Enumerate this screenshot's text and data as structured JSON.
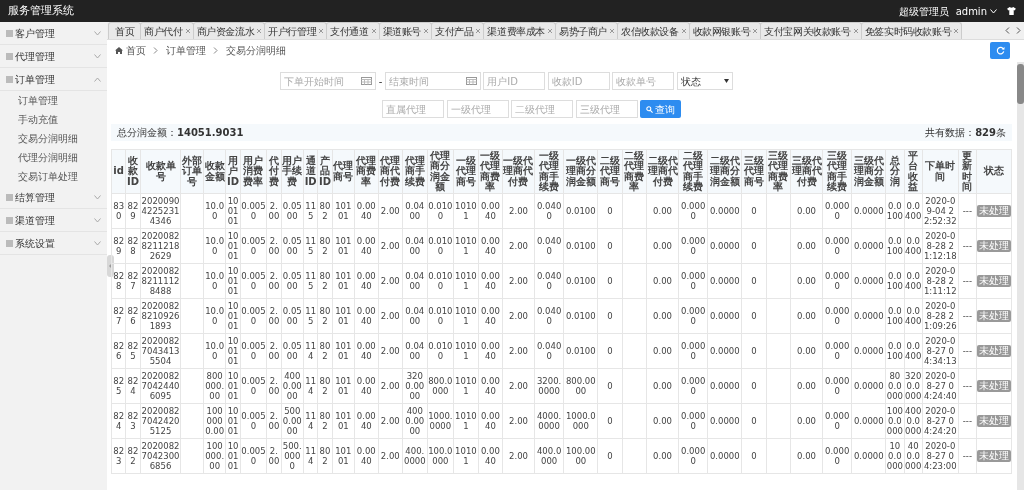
{
  "app": {
    "title": "服务管理系统",
    "user_role": "超级管理员",
    "user_name": "admin"
  },
  "sidebar": {
    "items": [
      {
        "label": "客户管理",
        "expanded": false
      },
      {
        "label": "代理管理",
        "expanded": false
      },
      {
        "label": "订单管理",
        "expanded": true,
        "children": [
          {
            "label": "订单管理"
          },
          {
            "label": "手动充值"
          },
          {
            "label": "交易分润明细"
          },
          {
            "label": "代理分润明细"
          },
          {
            "label": "交易订单处理"
          }
        ]
      },
      {
        "label": "结算管理",
        "expanded": false
      },
      {
        "label": "渠道管理",
        "expanded": false
      },
      {
        "label": "系统设置",
        "expanded": false
      }
    ]
  },
  "tabs": [
    {
      "label": "首页",
      "closable": false
    },
    {
      "label": "商户代付",
      "closable": true
    },
    {
      "label": "商户资金流水",
      "closable": true
    },
    {
      "label": "开户行管理",
      "closable": true
    },
    {
      "label": "支付通道",
      "closable": true
    },
    {
      "label": "渠道账号",
      "closable": true
    },
    {
      "label": "支付产品",
      "closable": true
    },
    {
      "label": "渠道费率成本",
      "closable": true
    },
    {
      "label": "易势子商户",
      "closable": true
    },
    {
      "label": "农信收款设备",
      "closable": true
    },
    {
      "label": "收款网银账号",
      "closable": true
    },
    {
      "label": "支付宝网关收款账号",
      "closable": true
    },
    {
      "label": "免签实时码收款账号",
      "closable": true
    }
  ],
  "breadcrumb": [
    "首页",
    "订单管理",
    "交易分润明细"
  ],
  "filters": {
    "row_1": [
      {
        "kind": "date",
        "placeholder": "下单开始时间"
      },
      {
        "kind": "separator",
        "text": "-"
      },
      {
        "kind": "date",
        "placeholder": "结束时间"
      },
      {
        "kind": "text",
        "placeholder": "用户ID"
      },
      {
        "kind": "text",
        "placeholder": "收款ID"
      },
      {
        "kind": "text",
        "placeholder": "收款单号"
      },
      {
        "kind": "select",
        "value": "状态"
      }
    ],
    "row_2": [
      {
        "kind": "text",
        "placeholder": "直属代理"
      },
      {
        "kind": "text",
        "placeholder": "一级代理"
      },
      {
        "kind": "text",
        "placeholder": "二级代理"
      },
      {
        "kind": "text",
        "placeholder": "三级代理"
      },
      {
        "kind": "button",
        "text": "查询"
      }
    ]
  },
  "summary": {
    "label": "总分润金额：",
    "value": "14051.9031",
    "count_label": "共有数据：",
    "count": "829",
    "count_unit": "条"
  },
  "table": {
    "columns": [
      "id",
      "收款ID",
      "收款单号",
      "外部订单号",
      "收款金额",
      "用户ID",
      "用户消费费率",
      "代付费",
      "用户手续费",
      "通道ID",
      "产品ID",
      "代理商号",
      "代理商费率",
      "代理商代付费",
      "代理商手续费",
      "代理商分润金额",
      "一级代理商号",
      "一级代理商费率",
      "一级代理商代付费",
      "一级代理商手续费",
      "一级代理商分润金额",
      "二级代理商号",
      "二级代理商费率",
      "二级代理商代付费",
      "二级代理商手续费",
      "二级代理商分润金额",
      "三级代理商号",
      "三级代理商费率",
      "三级代理商代付费",
      "三级代理商手续费",
      "三级代理商分润金额",
      "总分润",
      "平台收益",
      "下单时间",
      "更新时间",
      "状态"
    ],
    "rows": [
      [
        "830",
        "829",
        "202009042252314346",
        "",
        "10.00",
        "100101",
        "0.0050",
        "2.00",
        "0.0500",
        "115",
        "802",
        "10101",
        "0.0040",
        "2.00",
        "0.0400",
        "0.0100",
        "10101",
        "0.0040",
        "2.00",
        "0.0400",
        "0.0100",
        "0",
        "",
        "0.00",
        "0.0000",
        "0.0000",
        "0",
        "",
        "0.00",
        "0.0000",
        "0.0000",
        "0.0100",
        "0.0400",
        "2020-09-04 22:52:32",
        "---",
        "未处理"
      ],
      [
        "829",
        "828",
        "202008282112182629",
        "",
        "10.00",
        "100101",
        "0.0050",
        "2.00",
        "0.0500",
        "115",
        "802",
        "10101",
        "0.0040",
        "2.00",
        "0.0400",
        "0.0100",
        "10101",
        "0.0040",
        "2.00",
        "0.0400",
        "0.0100",
        "0",
        "",
        "0.00",
        "0.0000",
        "0.0000",
        "0",
        "",
        "0.00",
        "0.0000",
        "0.0000",
        "0.0100",
        "0.0400",
        "2020-08-28 21:12:18",
        "---",
        "未处理"
      ],
      [
        "828",
        "827",
        "202008282111128488",
        "",
        "10.00",
        "100101",
        "0.0050",
        "2.00",
        "0.0500",
        "115",
        "802",
        "10101",
        "0.0040",
        "2.00",
        "0.0400",
        "0.0100",
        "10101",
        "0.0040",
        "2.00",
        "0.0400",
        "0.0100",
        "0",
        "",
        "0.00",
        "0.0000",
        "0.0000",
        "0",
        "",
        "0.00",
        "0.0000",
        "0.0000",
        "0.0100",
        "0.0400",
        "2020-08-28 21:11:12",
        "---",
        "未处理"
      ],
      [
        "827",
        "826",
        "202008282109261893",
        "",
        "10.00",
        "100101",
        "0.0050",
        "2.00",
        "0.0500",
        "115",
        "802",
        "10101",
        "0.0040",
        "2.00",
        "0.0400",
        "0.0100",
        "10101",
        "0.0040",
        "2.00",
        "0.0400",
        "0.0100",
        "0",
        "",
        "0.00",
        "0.0000",
        "0.0000",
        "0",
        "",
        "0.00",
        "0.0000",
        "0.0000",
        "0.0100",
        "0.0400",
        "2020-08-28 21:09:26",
        "---",
        "未处理"
      ],
      [
        "826",
        "825",
        "202008270434135504",
        "",
        "10.00",
        "100101",
        "0.0050",
        "2.00",
        "0.0500",
        "114",
        "802",
        "10101",
        "0.0040",
        "2.00",
        "0.0400",
        "0.0100",
        "10101",
        "0.0040",
        "2.00",
        "0.0400",
        "0.0100",
        "0",
        "",
        "0.00",
        "0.0000",
        "0.0000",
        "0",
        "",
        "0.00",
        "0.0000",
        "0.0000",
        "0.0100",
        "0.0400",
        "2020-08-27 04:34:13",
        "---",
        "未处理"
      ],
      [
        "825",
        "824",
        "202008270424406095",
        "",
        "800000.00",
        "100101",
        "0.0050",
        "2.00",
        "4000.0000",
        "114",
        "802",
        "10101",
        "0.0040",
        "2.00",
        "3200.0000",
        "800.0000",
        "10101",
        "0.0040",
        "2.00",
        "3200.0000",
        "800.0000",
        "0",
        "",
        "0.00",
        "0.0000",
        "0.0000",
        "0",
        "",
        "0.00",
        "0.0000",
        "0.0000",
        "800.0000",
        "3200.0000",
        "2020-08-27 04:24:40",
        "---",
        "未处理"
      ],
      [
        "824",
        "823",
        "202008270424205125",
        "",
        "1000000.00",
        "100101",
        "0.0050",
        "2.00",
        "5000.0000",
        "114",
        "802",
        "10101",
        "0.0040",
        "2.00",
        "4000.0000",
        "1000.0000",
        "10101",
        "0.0040",
        "2.00",
        "4000.0000",
        "1000.0000",
        "0",
        "",
        "0.00",
        "0.0000",
        "0.0000",
        "0",
        "",
        "0.00",
        "0.0000",
        "0.0000",
        "1000.0000",
        "4000.0000",
        "2020-08-27 04:24:20",
        "---",
        "未处理"
      ],
      [
        "823",
        "822",
        "202008270423006856",
        "",
        "100000.00",
        "100101",
        "0.0050",
        "2.00",
        "500.0000",
        "114",
        "802",
        "10101",
        "0.0040",
        "2.00",
        "400.0000",
        "100.0000",
        "10101",
        "0.0040",
        "2.00",
        "400.0000",
        "100.0000",
        "0",
        "",
        "0.00",
        "0.0000",
        "0.0000",
        "0",
        "",
        "0.00",
        "0.0000",
        "0.0000",
        "100.0000",
        "400.0000",
        "2020-08-27 04:23:00",
        "---",
        "未处理"
      ]
    ]
  }
}
